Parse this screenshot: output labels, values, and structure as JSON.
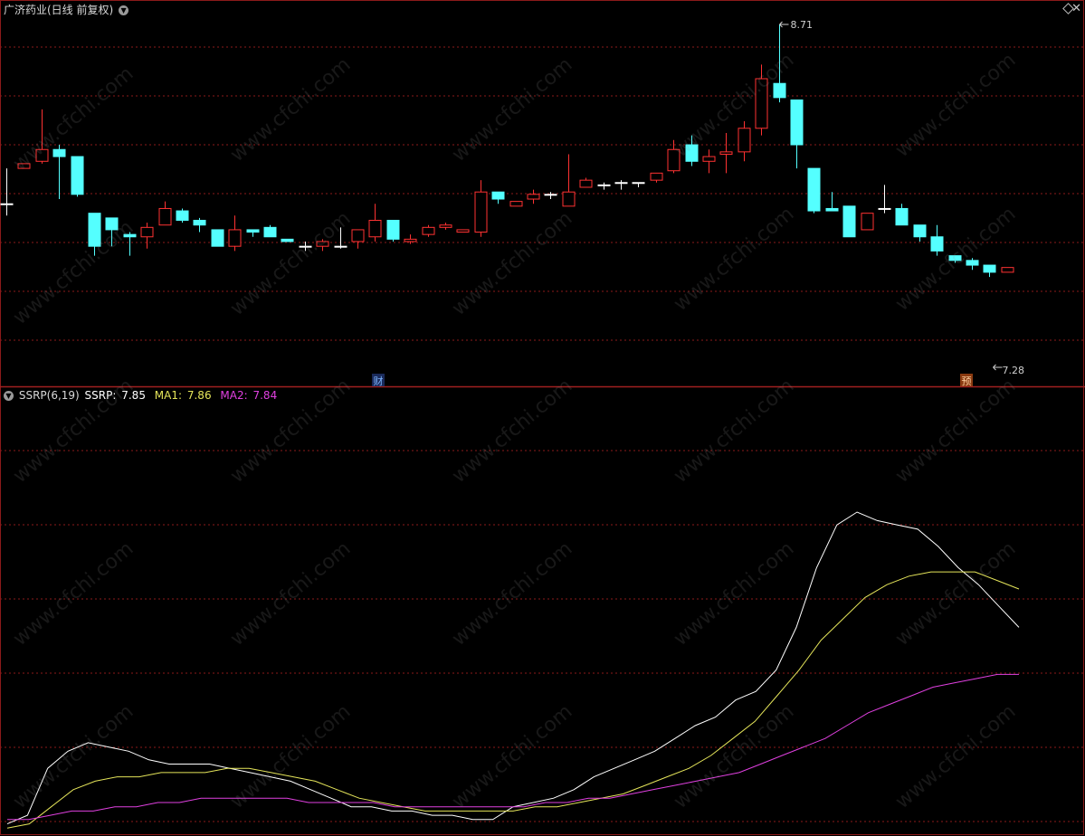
{
  "title": "广济药业(日线 前复权)",
  "indicator": {
    "name": "SSRP(6,19)",
    "ssrp_label": "SSRP:",
    "ssrp_value": "7.85",
    "ma1_label": "MA1:",
    "ma1_value": "7.86",
    "ma2_label": "MA2:",
    "ma2_value": "7.84"
  },
  "markers": {
    "high_label": "8.71",
    "low_label": "7.28",
    "cai_badge": "财",
    "yu_badge": "预"
  },
  "watermark": "www.cfchi.com",
  "colors": {
    "background": "#000000",
    "up": "#ff3232",
    "down": "#54ffff",
    "flat": "#ffffff",
    "grid": "#8b1a1a",
    "ssrp": "#ffffff",
    "ma1": "#e5e55a",
    "ma2": "#e040e0"
  },
  "chart_data": [
    {
      "type": "candlestick",
      "title": "广济药业(日线 前复权)",
      "ohlc": [
        [
          7.95,
          7.95,
          7.9,
          8.1
        ],
        [
          8.1,
          8.12,
          8.1,
          8.12
        ],
        [
          8.13,
          8.18,
          8.12,
          8.35
        ],
        [
          8.18,
          8.15,
          7.97,
          8.2
        ],
        [
          8.15,
          7.99,
          7.98,
          8.15
        ],
        [
          7.91,
          7.77,
          7.73,
          7.91
        ],
        [
          7.89,
          7.84,
          7.77,
          7.89
        ],
        [
          7.82,
          7.81,
          7.73,
          7.83
        ],
        [
          7.81,
          7.85,
          7.76,
          7.87
        ],
        [
          7.86,
          7.93,
          7.86,
          7.96
        ],
        [
          7.92,
          7.88,
          7.87,
          7.93
        ],
        [
          7.88,
          7.86,
          7.83,
          7.89
        ],
        [
          7.84,
          7.77,
          7.77,
          7.84
        ],
        [
          7.77,
          7.84,
          7.75,
          7.9
        ],
        [
          7.84,
          7.83,
          7.81,
          7.84
        ],
        [
          7.85,
          7.81,
          7.81,
          7.86
        ],
        [
          7.8,
          7.79,
          7.79,
          7.8
        ],
        [
          7.77,
          7.77,
          7.75,
          7.79
        ],
        [
          7.77,
          7.79,
          7.75,
          7.8
        ],
        [
          7.77,
          7.77,
          7.76,
          7.85
        ],
        [
          7.79,
          7.84,
          7.76,
          7.84
        ],
        [
          7.81,
          7.88,
          7.79,
          7.95
        ],
        [
          7.88,
          7.8,
          7.79,
          7.88
        ],
        [
          7.79,
          7.8,
          7.78,
          7.82
        ],
        [
          7.82,
          7.85,
          7.81,
          7.86
        ],
        [
          7.85,
          7.86,
          7.84,
          7.87
        ],
        [
          7.83,
          7.84,
          7.83,
          7.84
        ],
        [
          7.83,
          8.0,
          7.81,
          8.05
        ],
        [
          8.0,
          7.97,
          7.95,
          8.0
        ],
        [
          7.94,
          7.96,
          7.94,
          7.96
        ],
        [
          7.97,
          7.99,
          7.95,
          8.01
        ],
        [
          7.99,
          7.99,
          7.97,
          8.0
        ],
        [
          7.94,
          8.0,
          7.94,
          8.16
        ],
        [
          8.02,
          8.05,
          8.02,
          8.06
        ],
        [
          8.03,
          8.03,
          8.01,
          8.04
        ],
        [
          8.04,
          8.04,
          8.01,
          8.05
        ],
        [
          8.04,
          8.04,
          8.02,
          8.04
        ],
        [
          8.05,
          8.08,
          8.04,
          8.08
        ],
        [
          8.09,
          8.18,
          8.08,
          8.22
        ],
        [
          8.2,
          8.13,
          8.11,
          8.24
        ],
        [
          8.13,
          8.15,
          8.08,
          8.18
        ],
        [
          8.16,
          8.17,
          8.08,
          8.25
        ],
        [
          8.17,
          8.27,
          8.13,
          8.3
        ],
        [
          8.27,
          8.48,
          8.24,
          8.54
        ],
        [
          8.46,
          8.4,
          8.38,
          8.71
        ],
        [
          8.39,
          8.2,
          8.1,
          8.39
        ],
        [
          8.1,
          7.92,
          7.91,
          8.1
        ],
        [
          7.93,
          7.92,
          7.92,
          8.0
        ],
        [
          7.94,
          7.81,
          7.81,
          7.94
        ],
        [
          7.84,
          7.91,
          7.84,
          7.91
        ],
        [
          7.93,
          7.93,
          7.91,
          8.03
        ],
        [
          7.93,
          7.86,
          7.86,
          7.95
        ],
        [
          7.86,
          7.81,
          7.79,
          7.86
        ],
        [
          7.81,
          7.75,
          7.73,
          7.86
        ],
        [
          7.73,
          7.71,
          7.7,
          7.73
        ],
        [
          7.71,
          7.69,
          7.67,
          7.72
        ],
        [
          7.69,
          7.66,
          7.64,
          7.69
        ],
        [
          7.66,
          7.68,
          7.67,
          7.68
        ]
      ],
      "marked_high": 8.71,
      "marked_low": 7.28
    },
    {
      "type": "line",
      "title": "SSRP(6,19)",
      "ylim": [
        0,
        100
      ],
      "series": [
        {
          "name": "SSRP",
          "values": [
            2,
            4,
            15,
            19,
            21,
            20,
            19,
            17,
            16,
            16,
            16,
            15,
            14,
            13,
            12,
            10,
            8,
            6,
            6,
            5,
            5,
            4,
            4,
            3,
            3,
            6,
            7,
            8,
            10,
            13,
            15,
            17,
            19,
            22,
            25,
            27,
            31,
            33,
            38,
            48,
            62,
            72,
            75,
            73,
            72,
            71,
            67,
            62,
            58,
            53,
            48
          ]
        },
        {
          "name": "MA1",
          "values": [
            1,
            2,
            6,
            10,
            12,
            13,
            13,
            14,
            14,
            14,
            15,
            15,
            14,
            13,
            12,
            10,
            8,
            7,
            6,
            5,
            5,
            5,
            5,
            5,
            6,
            6,
            7,
            8,
            9,
            11,
            13,
            15,
            18,
            22,
            26,
            32,
            38,
            45,
            50,
            55,
            58,
            60,
            61,
            61,
            61,
            59,
            57
          ]
        },
        {
          "name": "MA2",
          "values": [
            3,
            3,
            4,
            5,
            5,
            6,
            6,
            7,
            7,
            8,
            8,
            8,
            8,
            8,
            7,
            7,
            7,
            7,
            6,
            6,
            6,
            6,
            6,
            6,
            6,
            7,
            7,
            8,
            8,
            9,
            10,
            11,
            12,
            13,
            14,
            16,
            18,
            20,
            22,
            25,
            28,
            30,
            32,
            34,
            35,
            36,
            37,
            37
          ]
        }
      ]
    }
  ]
}
